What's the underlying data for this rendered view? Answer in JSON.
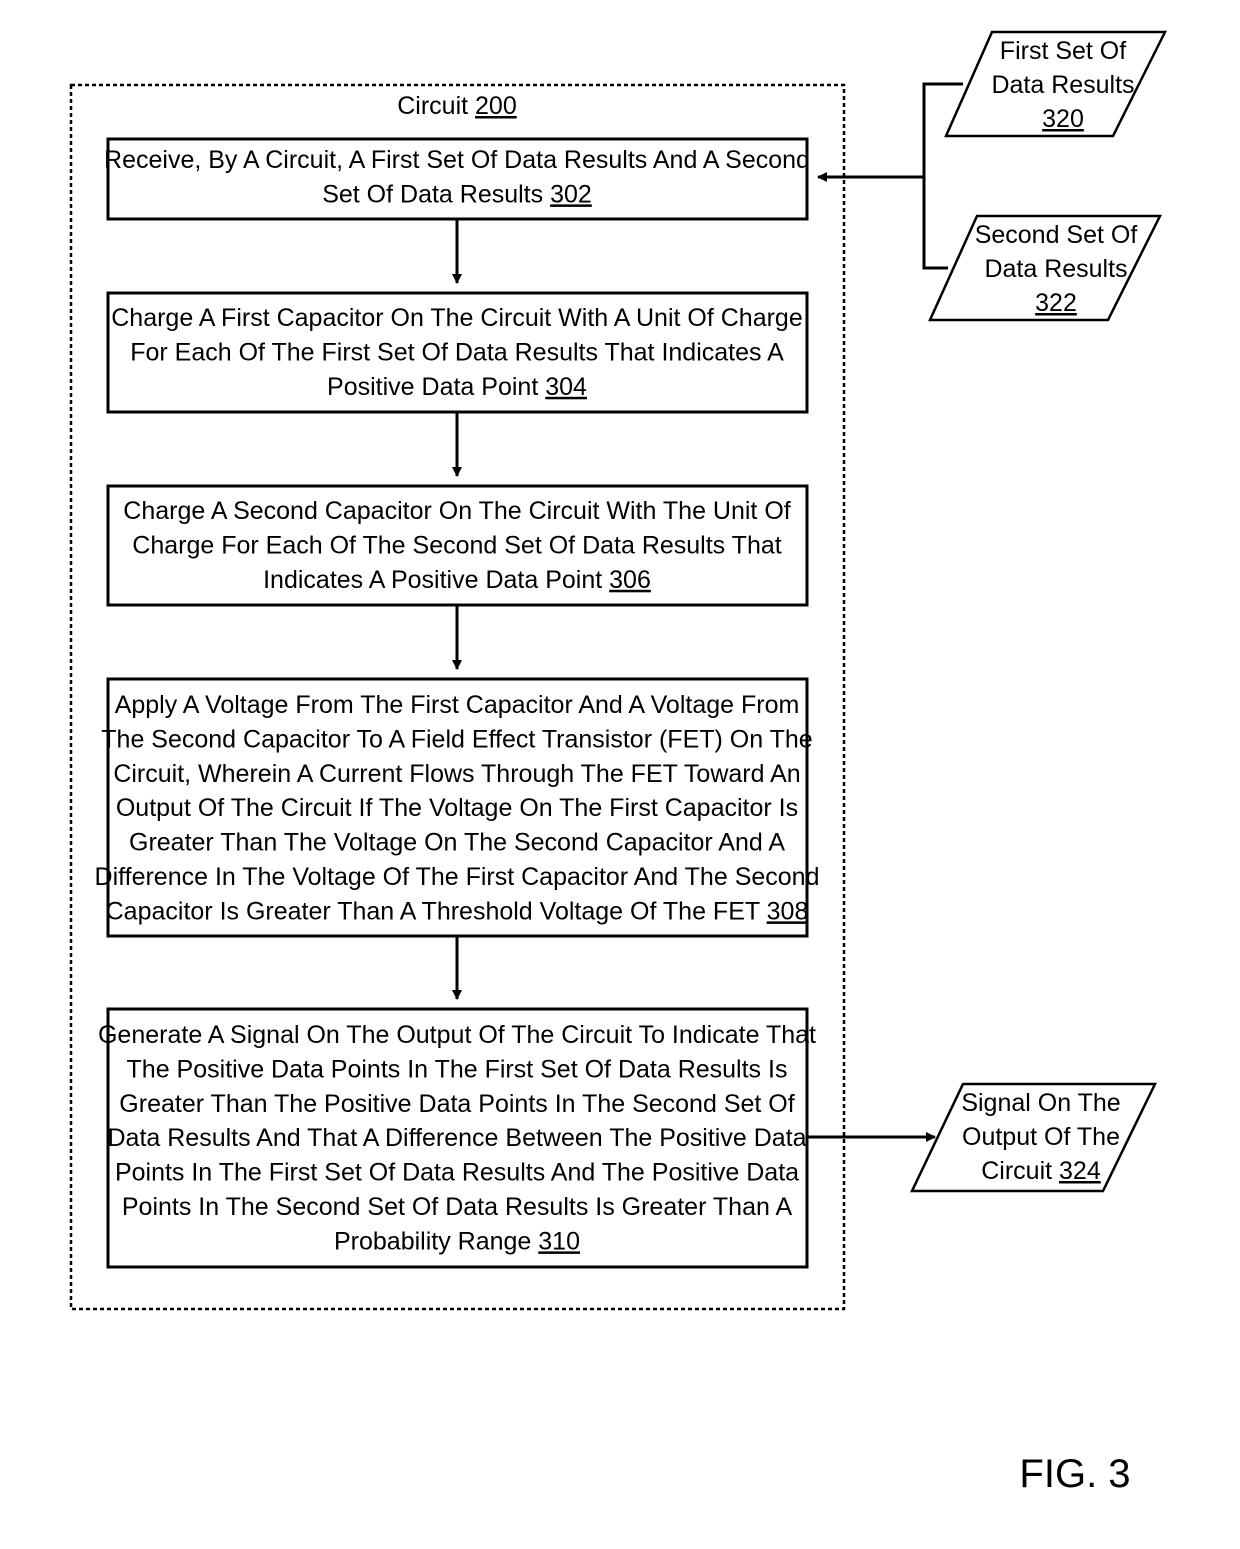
{
  "figure_label": "FIG. 3",
  "container": {
    "title": "Circuit",
    "ref": "200"
  },
  "steps": [
    {
      "id": "302",
      "lines": [
        "Receive, By A Circuit, A First Set Of Data Results And A Second",
        "Set Of Data Results"
      ],
      "ref": "302"
    },
    {
      "id": "304",
      "lines": [
        "Charge A First Capacitor On The Circuit With A Unit Of Charge",
        "For Each Of The First Set Of Data Results That Indicates A",
        "Positive Data Point"
      ],
      "ref": "304"
    },
    {
      "id": "306",
      "lines": [
        "Charge A Second Capacitor On The Circuit With The Unit Of",
        "Charge For Each Of The Second Set Of Data Results That",
        "Indicates A Positive Data Point"
      ],
      "ref": "306"
    },
    {
      "id": "308",
      "lines": [
        "Apply A Voltage From The First Capacitor And A Voltage From",
        "The Second Capacitor To A Field Effect Transistor (FET) On The",
        "Circuit, Wherein A Current Flows Through The FET Toward An",
        "Output Of The Circuit If The Voltage On The First Capacitor Is",
        "Greater Than The Voltage On The Second Capacitor And A",
        "Difference In The Voltage Of The First Capacitor And The Second",
        "Capacitor Is Greater Than A Threshold Voltage Of The FET"
      ],
      "ref": "308"
    },
    {
      "id": "310",
      "lines": [
        "Generate A Signal On The Output Of The Circuit To Indicate That",
        "The Positive Data Points In The First Set Of Data Results Is",
        "Greater Than The Positive Data Points In The Second Set Of",
        "Data Results And That A Difference Between The Positive Data",
        "Points In The First Set Of Data Results And The Positive Data",
        "Points In The Second Set Of Data Results Is Greater Than A",
        "Probability Range"
      ],
      "ref": "310"
    }
  ],
  "data_inputs": [
    {
      "id": "320",
      "lines": [
        "First Set Of",
        "Data Results"
      ],
      "ref": "320"
    },
    {
      "id": "322",
      "lines": [
        "Second Set Of",
        "Data Results"
      ],
      "ref": "322"
    }
  ],
  "data_output": {
    "id": "324",
    "lines": [
      "Signal On The",
      "Output Of The",
      "Circuit"
    ],
    "ref": "324"
  }
}
